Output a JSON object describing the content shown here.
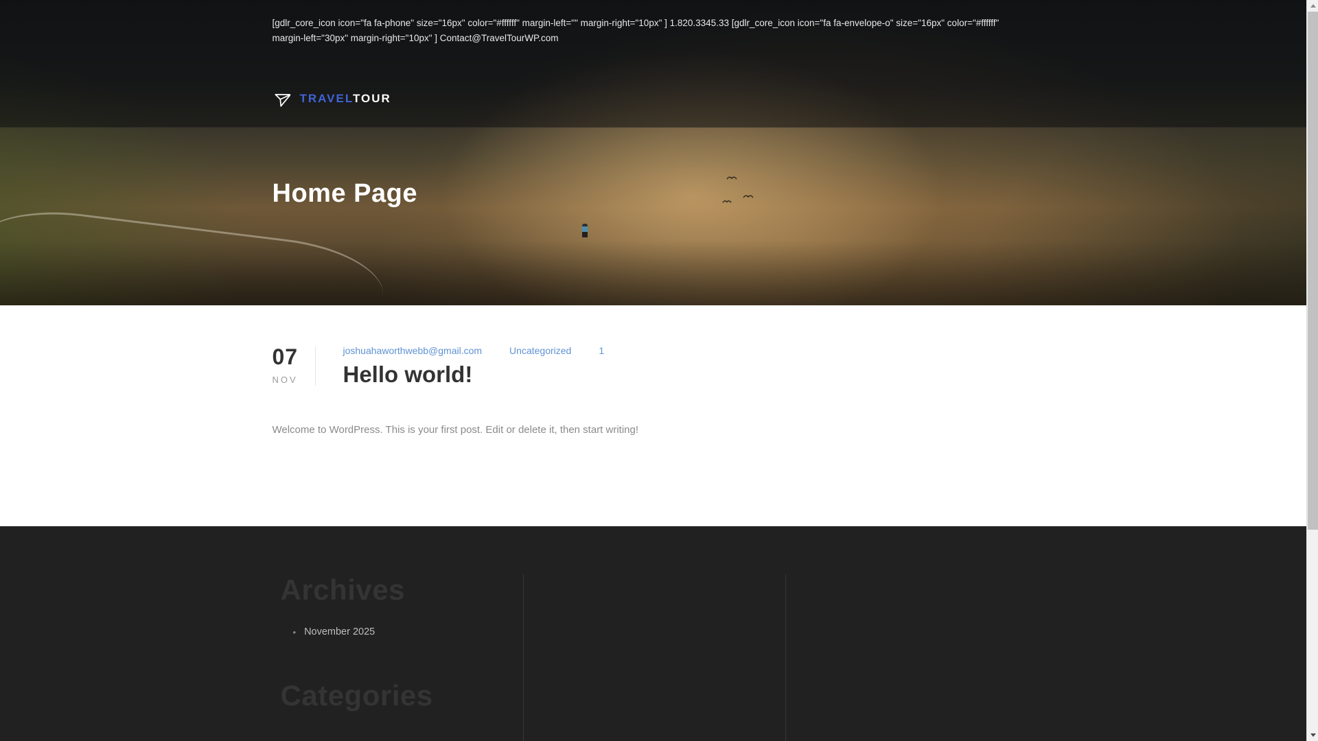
{
  "topbar": {
    "line1": "[gdlr_core_icon icon=\"fa fa-phone\" size=\"16px\" color=\"#ffffff\" margin-left=\"\" margin-right=\"10px\" ] 1.820.3345.33 [gdlr_core_icon icon=\"fa fa-envelope-o\" size=\"16px\" color=\"#ffffff\"",
    "line2": "margin-left=\"30px\" margin-right=\"10px\" ] Contact@TravelTourWP.com"
  },
  "header": {
    "logo_primary": "TRAVEL",
    "logo_secondary": "TOUR"
  },
  "hero": {
    "title": "Home Page"
  },
  "post": {
    "day": "07",
    "month": "NOV",
    "author": "joshuahaworthwebb@gmail.com",
    "category": "Uncategorized",
    "comments": "1",
    "title": "Hello world!",
    "excerpt": "Welcome to WordPress. This is your first post. Edit or delete it, then start writing!"
  },
  "footer": {
    "widgets": [
      {
        "title": "Archives",
        "items": [
          "November 2025"
        ]
      },
      {
        "title": "Categories",
        "items": []
      }
    ]
  },
  "icons": {
    "logo": "plane-icon",
    "birds": "bird-icon",
    "scroll_up": "arrow-up-icon",
    "scroll_down": "arrow-down-icon",
    "list_bullet": "bullet-dot"
  },
  "colors": {
    "logo_accent": "#4064d8",
    "link_blue": "#5e92d4",
    "heading_dark": "#333333",
    "body_gray": "#8a8a8a",
    "footer_bg": "#212121",
    "footer_heading": "#343434",
    "footer_text": "#bdbdbd",
    "topbar_text": "#e9e9e9"
  }
}
